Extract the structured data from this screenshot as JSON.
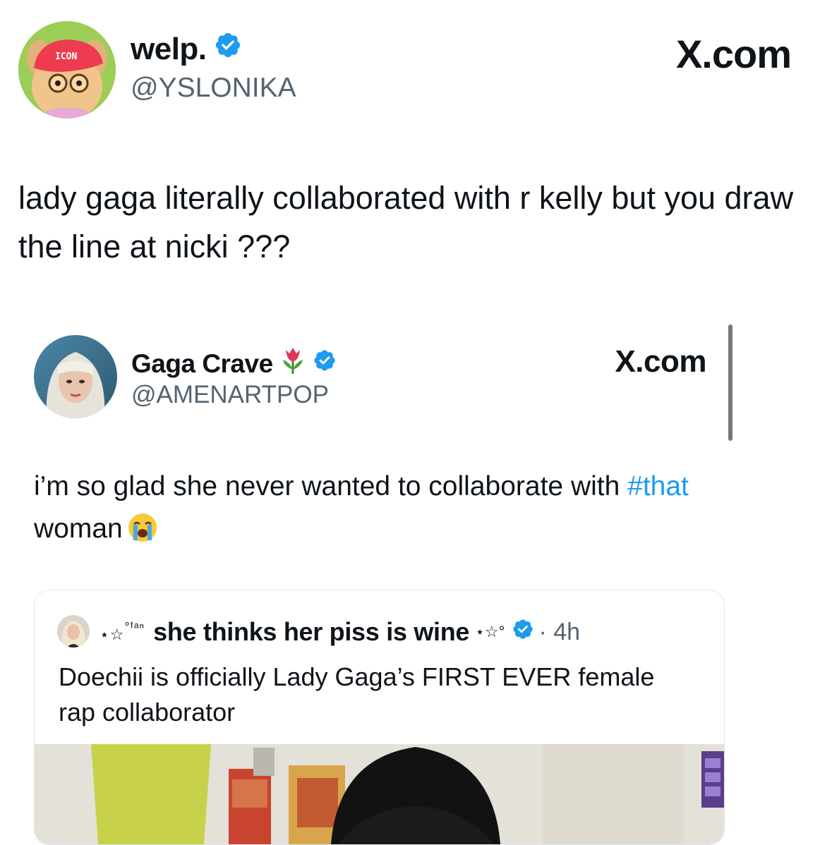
{
  "outer": {
    "display_name": "welp.",
    "handle": "@YSLONIKA",
    "brand": "X.com",
    "avatar_cap_text": "ICON",
    "text": "lady gaga literally collaborated with r kelly but you draw the line at nicki ???"
  },
  "quote": {
    "display_name": "Gaga Crave",
    "name_emoji": "tulip",
    "handle": "@AMENARTPOP",
    "brand": "X.com",
    "text_before": "i’m so glad she never wanted to collaborate with ",
    "hashtag": "#that",
    "text_after": " woman",
    "emoji": "loudly-crying-face"
  },
  "nested": {
    "prefix": "⋆☆",
    "prefix_sup": "°ᶠᵃⁿ",
    "display_name": "she thinks her piss is wine",
    "suffix": "⋆☆°",
    "time": "· 4h",
    "text": "Doechii is officially Lady Gaga’s FIRST EVER female rap collaborator"
  },
  "colors": {
    "accent": "#1d9bf0",
    "secondary_text": "#536471",
    "verified": "#1d9bf0"
  }
}
